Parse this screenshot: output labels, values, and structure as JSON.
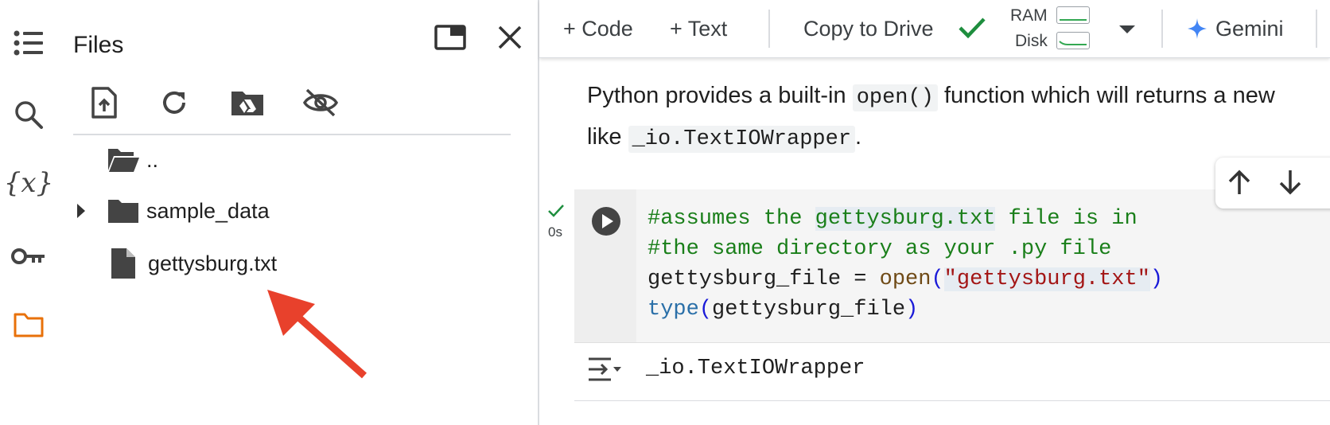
{
  "files_panel": {
    "title": "Files",
    "items": [
      {
        "label": ".."
      },
      {
        "label": "sample_data"
      },
      {
        "label": "gettysburg.txt"
      }
    ]
  },
  "toolbar": {
    "code_label": "+ Code",
    "text_label": "+ Text",
    "copy_label": "Copy to Drive",
    "ram_label": "RAM",
    "disk_label": "Disk",
    "gemini_label": "Gemini"
  },
  "text_cell": {
    "line1_a": "Python provides a built-in ",
    "line1_code": "open()",
    "line1_b": " function which will returns a new",
    "line2_a": "like ",
    "line2_code": "_io.TextIOWrapper",
    "line2_b": "."
  },
  "code_cell": {
    "exec_time": "0s",
    "line1_a": "#assumes the ",
    "line1_hl": "gettysburg.txt",
    "line1_b": " file is in",
    "line2": "#the same directory as your .py file",
    "line3_var": "gettysburg_file = ",
    "line3_fn": "open",
    "line3_lp": "(",
    "line3_str": "\"gettysburg.txt\"",
    "line3_rp": ")",
    "line4_fn": "type",
    "line4_lp": "(",
    "line4_arg": "gettysburg_file",
    "line4_rp": ")",
    "output": "_io.TextIOWrapper"
  },
  "colors": {
    "accent_orange": "#e8710a",
    "arrow_red": "#e8412c",
    "check_green": "#1e8e3e",
    "gemini_blue": "#4285f4"
  }
}
